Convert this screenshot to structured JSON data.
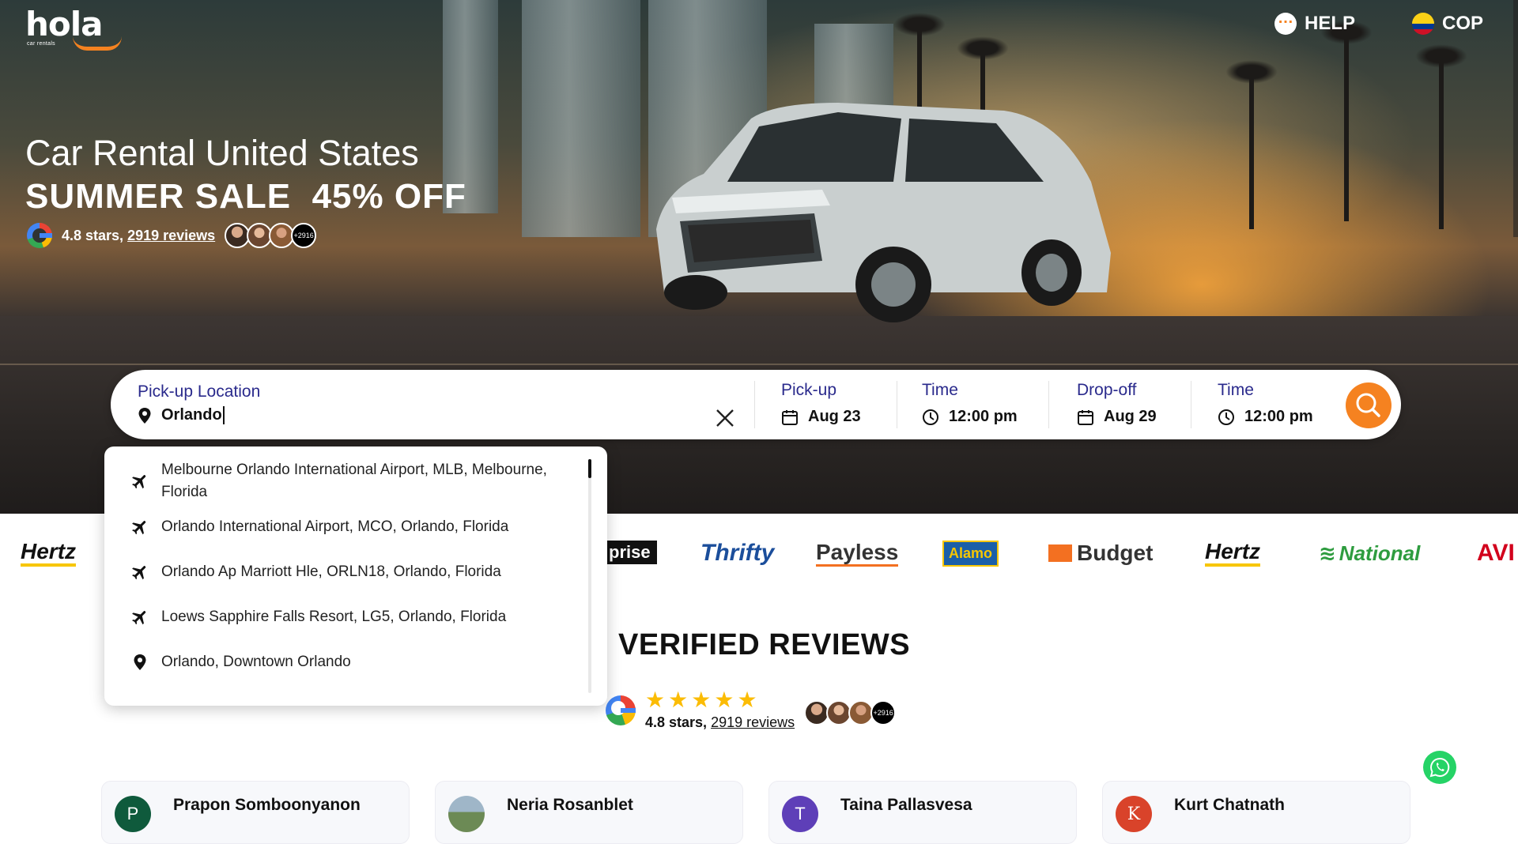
{
  "header": {
    "logo_text": "hola",
    "logo_sub": "car rentals",
    "help_label": "HELP",
    "currency_label": "COP"
  },
  "hero": {
    "title": "Car Rental United States",
    "sale": "SUMMER SALE  45% OFF",
    "rating_prefix": "4.8 stars, ",
    "rating_link": "2919 reviews",
    "avatars_more": "+2916"
  },
  "search": {
    "pickup_location_label": "Pick-up Location",
    "pickup_location_value": "Orlando",
    "pickup_label": "Pick-up",
    "pickup_date": "Aug 23",
    "pickup_time_label": "Time",
    "pickup_time": "12:00 pm",
    "dropoff_label": "Drop-off",
    "dropoff_date": "Aug 29",
    "dropoff_time_label": "Time",
    "dropoff_time": "12:00 pm"
  },
  "suggestions": [
    {
      "icon": "plane-icon",
      "text_line1": "Melbourne Orlando International Airport, MLB, Melbourne,",
      "text_line2": "Florida"
    },
    {
      "icon": "plane-icon",
      "text_line1": "Orlando International Airport, MCO, Orlando, Florida"
    },
    {
      "icon": "plane-icon",
      "text_line1": "Orlando Ap Marriott Hle, ORLN18, Orlando, Florida"
    },
    {
      "icon": "plane-icon",
      "text_line1": "Loews Sapphire Falls Resort, LG5, Orlando, Florida"
    },
    {
      "icon": "location-pin-icon",
      "text_line1": "Orlando, Downtown Orlando"
    }
  ],
  "brands": [
    "Hertz",
    "prise",
    "Thrifty",
    "Payless",
    "Alamo",
    "Budget",
    "Hertz",
    "National",
    "AVI"
  ],
  "brand_colors": {
    "hertz": "#111111",
    "hertz_bar": "#f7c600",
    "thrifty": "#1b4e9b",
    "alamo": "#1b5fa8",
    "budget": "#f37021",
    "national": "#2e9c3f",
    "avis": "#d2001c",
    "accent": "#f58220"
  },
  "reviews": {
    "title": "VERIFIED REVIEWS",
    "rating_prefix": "4.8 stars, ",
    "rating_link": "2919 reviews",
    "avatars_more": "+2916",
    "stars": 5,
    "cards": [
      {
        "initial": "P",
        "name": "Prapon Somboonyanon"
      },
      {
        "initial": "",
        "name": "Neria Rosanblet"
      },
      {
        "initial": "T",
        "name": "Taina Pallasvesa"
      },
      {
        "initial": "K",
        "name": "Kurt Chatnath"
      }
    ]
  }
}
